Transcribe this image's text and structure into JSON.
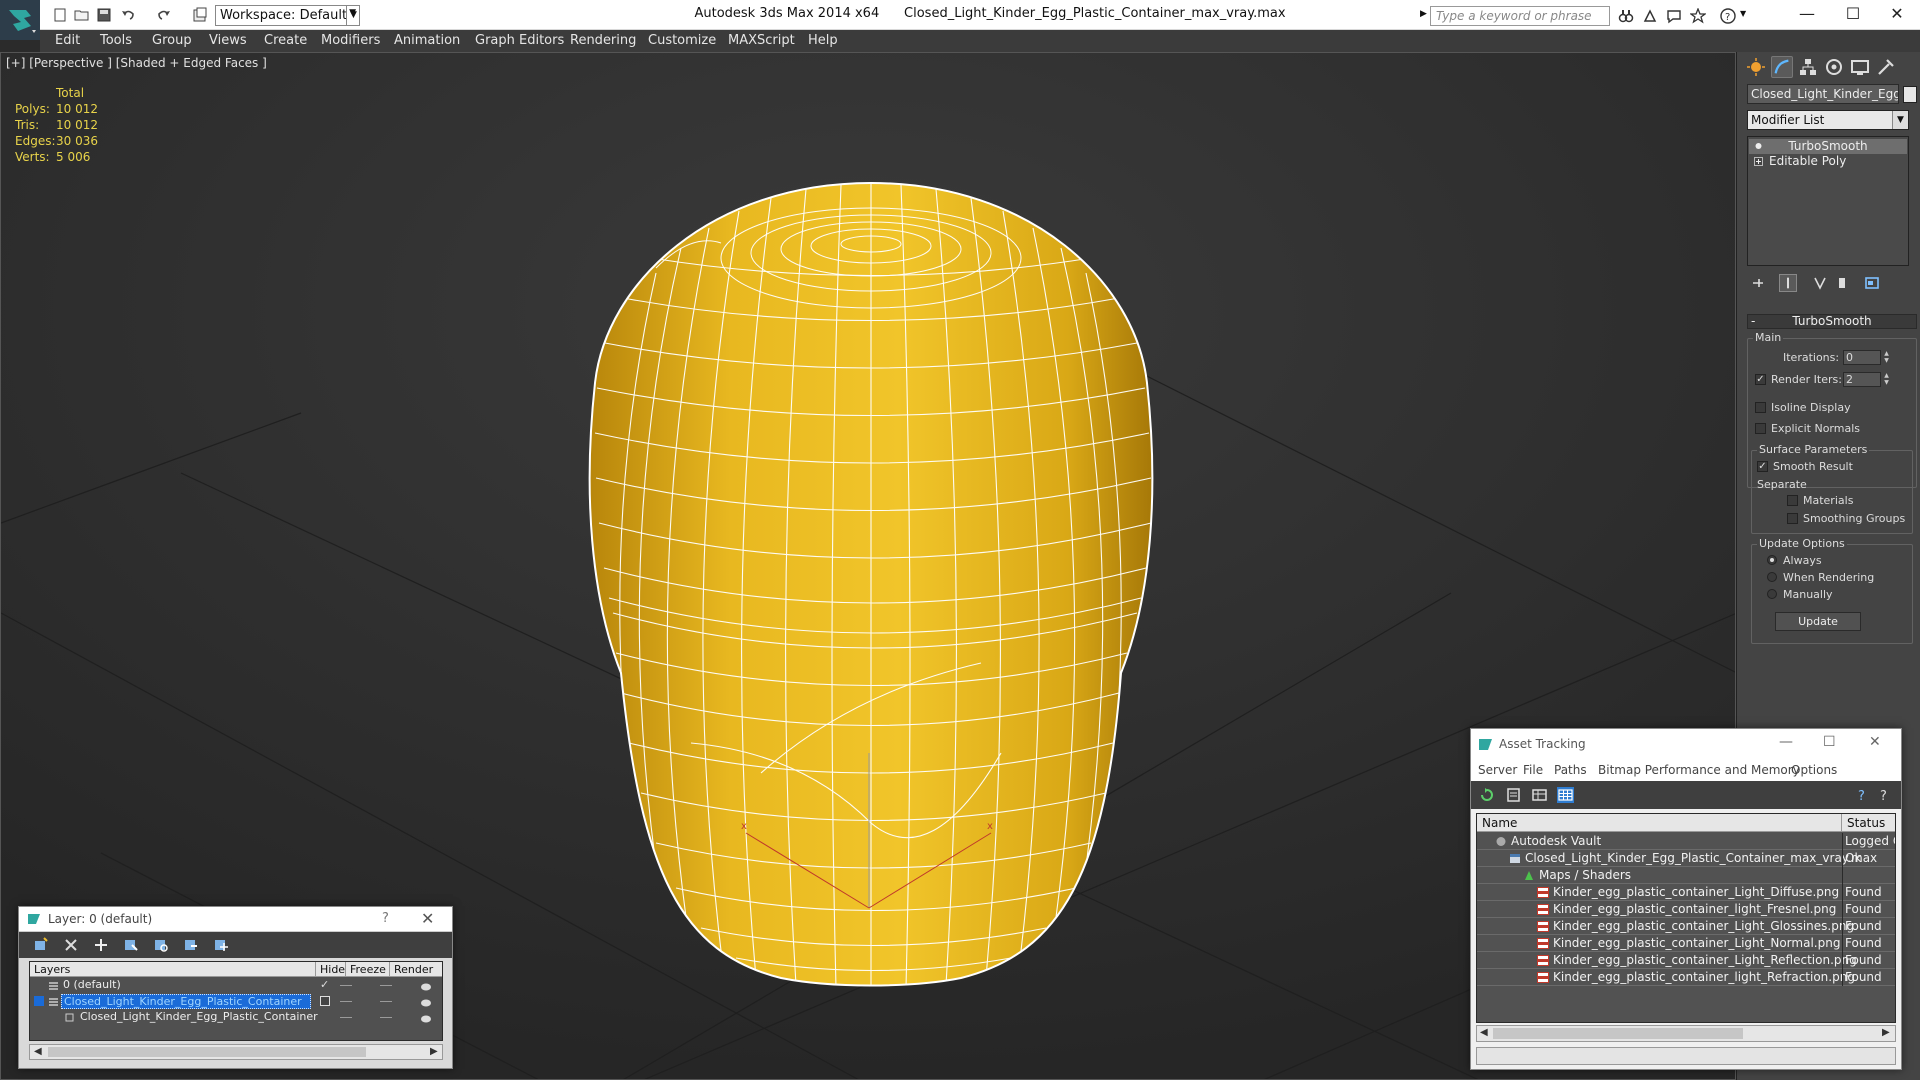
{
  "titlebar": {
    "workspace_label": "Workspace: Default",
    "title_app": "Autodesk 3ds Max  2014 x64",
    "title_file": "Closed_Light_Kinder_Egg_Plastic_Container_max_vray.max",
    "search_placeholder": "Type a keyword or phrase"
  },
  "menubar": {
    "items": [
      "Edit",
      "Tools",
      "Group",
      "Views",
      "Create",
      "Modifiers",
      "Animation",
      "Graph Editors",
      "Rendering",
      "Customize",
      "MAXScript",
      "Help"
    ]
  },
  "viewport": {
    "label": "[+] [Perspective ] [Shaded + Edged Faces ]",
    "stats": {
      "header": "Total",
      "rows": [
        {
          "k": "Polys:",
          "v": "10 012"
        },
        {
          "k": "Tris:",
          "v": "10 012"
        },
        {
          "k": "Edges:",
          "v": "30 036"
        },
        {
          "k": "Verts:",
          "v": "5 006"
        }
      ]
    },
    "colors": {
      "object": "#e8b820",
      "wire": "#ffffff",
      "grid": "#1f1f1f",
      "stats_text": "#e8d34a"
    }
  },
  "command_panel": {
    "object_name": "Closed_Light_Kinder_Egg_Pla",
    "modifier_list": "Modifier List",
    "stack": [
      "TurboSmooth",
      "Editable Poly"
    ],
    "rollout_title": "TurboSmooth",
    "main": {
      "group": "Main",
      "iterations_label": "Iterations:",
      "iterations_value": "0",
      "render_iters_label": "Render Iters:",
      "render_iters_value": "2",
      "isoline_label": "Isoline Display",
      "explicit_label": "Explicit Normals"
    },
    "surface": {
      "group": "Surface Parameters",
      "smooth_result": "Smooth Result",
      "separate": "Separate",
      "materials": "Materials",
      "smoothing_groups": "Smoothing Groups"
    },
    "update": {
      "group": "Update Options",
      "always": "Always",
      "when_rendering": "When Rendering",
      "manually": "Manually",
      "button": "Update"
    }
  },
  "layer_dialog": {
    "title": "Layer: 0 (default)",
    "help": "?",
    "close": "✕",
    "columns": [
      "Layers",
      "Hide",
      "Freeze",
      "Render"
    ],
    "rows": [
      "0 (default)",
      "Closed_Light_Kinder_Egg_Plastic_Container",
      "Closed_Light_Kinder_Egg_Plastic_Container"
    ]
  },
  "asset_dialog": {
    "title": "Asset Tracking",
    "menu": [
      "Server",
      "File",
      "Paths",
      "Bitmap Performance and Memory",
      "Options"
    ],
    "columns": [
      "Name",
      "Status"
    ],
    "rows": [
      {
        "name": "Autodesk Vault",
        "status": "Logged O"
      },
      {
        "name": "Closed_Light_Kinder_Egg_Plastic_Container_max_vray.max",
        "status": "Ok"
      },
      {
        "name": "Maps / Shaders",
        "status": ""
      },
      {
        "name": "Kinder_egg_plastic_container_Light_Diffuse.png",
        "status": "Found"
      },
      {
        "name": "Kinder_egg_plastic_container_light_Fresnel.png",
        "status": "Found"
      },
      {
        "name": "Kinder_egg_plastic_container_Light_Glossines.png",
        "status": "Found"
      },
      {
        "name": "Kinder_egg_plastic_container_Light_Normal.png",
        "status": "Found"
      },
      {
        "name": "Kinder_egg_plastic_container_Light_Reflection.png",
        "status": "Found"
      },
      {
        "name": "Kinder_egg_plastic_container_light_Refraction.png",
        "status": "Found"
      }
    ]
  }
}
